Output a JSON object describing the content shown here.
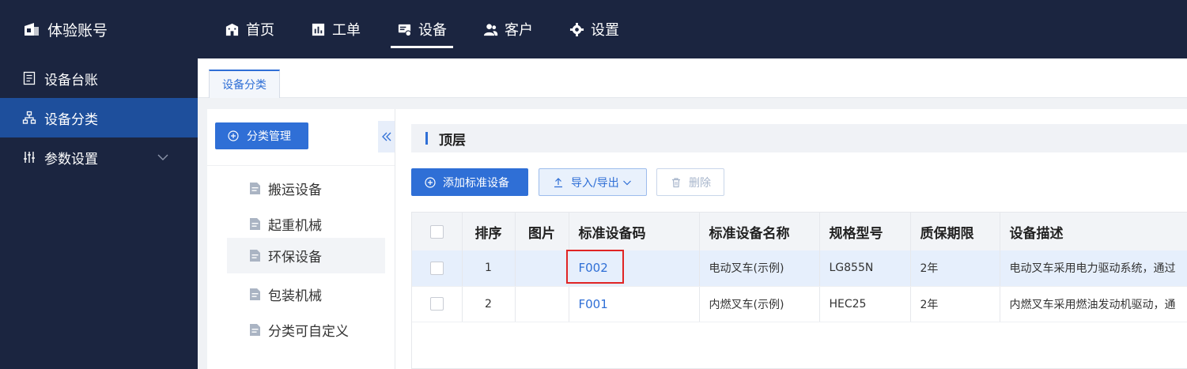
{
  "brand": {
    "title": "体验账号"
  },
  "nav": [
    {
      "label": "首页",
      "icon": "building-icon"
    },
    {
      "label": "工单",
      "icon": "chart-icon"
    },
    {
      "label": "设备",
      "icon": "device-icon",
      "active": true
    },
    {
      "label": "客户",
      "icon": "users-icon"
    },
    {
      "label": "设置",
      "icon": "gear-icon"
    }
  ],
  "sidebar": {
    "items": [
      {
        "label": "设备台账",
        "icon": "ledger-icon"
      },
      {
        "label": "设备分类",
        "icon": "hierarchy-icon",
        "active": true
      },
      {
        "label": "参数设置",
        "icon": "sliders-icon",
        "expandable": true
      }
    ]
  },
  "tabs": [
    {
      "label": "设备分类",
      "active": true
    }
  ],
  "category_panel": {
    "manage_button": "分类管理",
    "items": [
      "搬运设备",
      "起重机械",
      "环保设备",
      "包装机械",
      "分类可自定义"
    ],
    "selected_index": 2
  },
  "content": {
    "crumb": "顶层",
    "buttons": {
      "add": "添加标准设备",
      "import_export": "导入/导出",
      "delete": "删除"
    },
    "table": {
      "columns": [
        "排序",
        "图片",
        "标准设备码",
        "标准设备名称",
        "规格型号",
        "质保期限",
        "设备描述"
      ],
      "rows": [
        {
          "order": "1",
          "image": "",
          "code": "F002",
          "name": "电动叉车(示例)",
          "model": "LG855N",
          "warranty": "2年",
          "desc": "电动叉车采用电力驱动系统，通过",
          "highlight": true
        },
        {
          "order": "2",
          "image": "",
          "code": "F001",
          "name": "内燃叉车(示例)",
          "model": "HEC25",
          "warranty": "2年",
          "desc": "内燃叉车采用燃油发动机驱动，通"
        }
      ]
    }
  },
  "colors": {
    "topbar": "#1b2540",
    "accent": "#2f6fd6",
    "sidebar_active": "#1e4f9c",
    "highlight_box": "#e02424"
  }
}
